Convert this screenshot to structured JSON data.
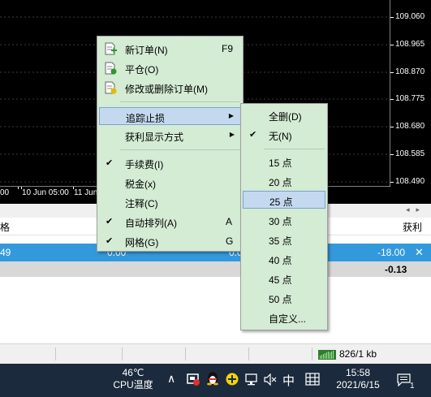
{
  "chart": {
    "prices": [
      "109.060",
      "108.965",
      "108.870",
      "108.775",
      "108.680",
      "108.585",
      "108.490"
    ],
    "time_labels": [
      "00",
      "10 Jun 05:00",
      "11 Jun"
    ]
  },
  "terminal": {
    "header_left": "格",
    "header_profit": "获利",
    "selected_row": {
      "left": "49",
      "mid1": "0.00",
      "mid2": "0.0",
      "profit": "-18.00",
      "close_symbol": "✕"
    },
    "total_row": {
      "profit": "-0.13"
    },
    "scroll_arrows": "◂▸"
  },
  "statusbar": {
    "traffic": "826/1 kb"
  },
  "taskbar": {
    "temperature": "46℃",
    "temperature_label": "CPU温度",
    "chevron": "∧",
    "ime": "中",
    "time": "15:58",
    "date": "2021/6/15",
    "notification_count": "1"
  },
  "main_menu": {
    "items": [
      {
        "label": "新订单(N)",
        "key": "F9",
        "icon": "new-order-icon"
      },
      {
        "label": "平仓(O)",
        "icon": "close-order-icon"
      },
      {
        "label": "修改或删除订单(M)",
        "icon": "modify-order-icon"
      },
      {
        "label": "追踪止损",
        "submenu": true
      },
      {
        "label": "获利显示方式",
        "submenu": true
      },
      {
        "label": "手续费(I)",
        "checked": true
      },
      {
        "label": "税金(x)"
      },
      {
        "label": "注释(C)"
      },
      {
        "label": "自动排列(A)",
        "key": "A",
        "checked": true
      },
      {
        "label": "网格(G)",
        "key": "G",
        "checked": true
      }
    ],
    "check_mark": "✔",
    "arrow": "▶"
  },
  "sub_menu": {
    "items": [
      {
        "label": "全删(D)"
      },
      {
        "label": "无(N)",
        "checked": true
      },
      {
        "label": "15 点"
      },
      {
        "label": "20 点"
      },
      {
        "label": "25 点",
        "highlighted": true
      },
      {
        "label": "30 点"
      },
      {
        "label": "35 点"
      },
      {
        "label": "40 点"
      },
      {
        "label": "45 点"
      },
      {
        "label": "50 点"
      },
      {
        "label": "自定义..."
      }
    ]
  },
  "colors": {
    "menu_bg": "#d4ebd4",
    "highlight": "#c4d9ef",
    "selected_row": "#3399dd",
    "taskbar": "#1b2a3c"
  }
}
